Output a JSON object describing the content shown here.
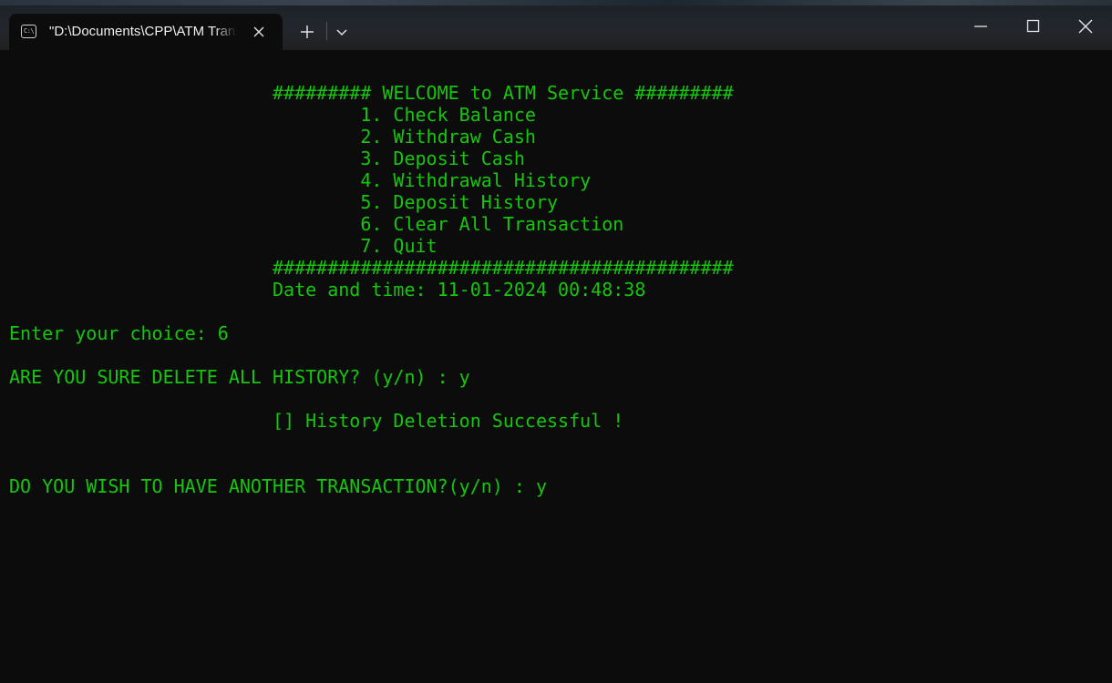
{
  "window": {
    "tab_title": "\"D:\\Documents\\CPP\\ATM Transaction",
    "tab_icon": "console-icon",
    "accent_text_color": "#16c60c",
    "background_color": "#0c0c0c"
  },
  "terminal": {
    "lines": [
      "",
      "                        ######### WELCOME to ATM Service #########",
      "                                1. Check Balance",
      "                                2. Withdraw Cash",
      "                                3. Deposit Cash",
      "                                4. Withdrawal History",
      "                                5. Deposit History",
      "                                6. Clear All Transaction",
      "                                7. Quit",
      "                        ##########################################",
      "                        Date and time: 11-01-2024 00:48:38",
      "",
      "Enter your choice: 6",
      "",
      "ARE YOU SURE DELETE ALL HISTORY? (y/n) : y",
      "",
      "                        [] History Deletion Successful !",
      "",
      "",
      "DO YOU WISH TO HAVE ANOTHER TRANSACTION?(y/n) : y"
    ]
  }
}
